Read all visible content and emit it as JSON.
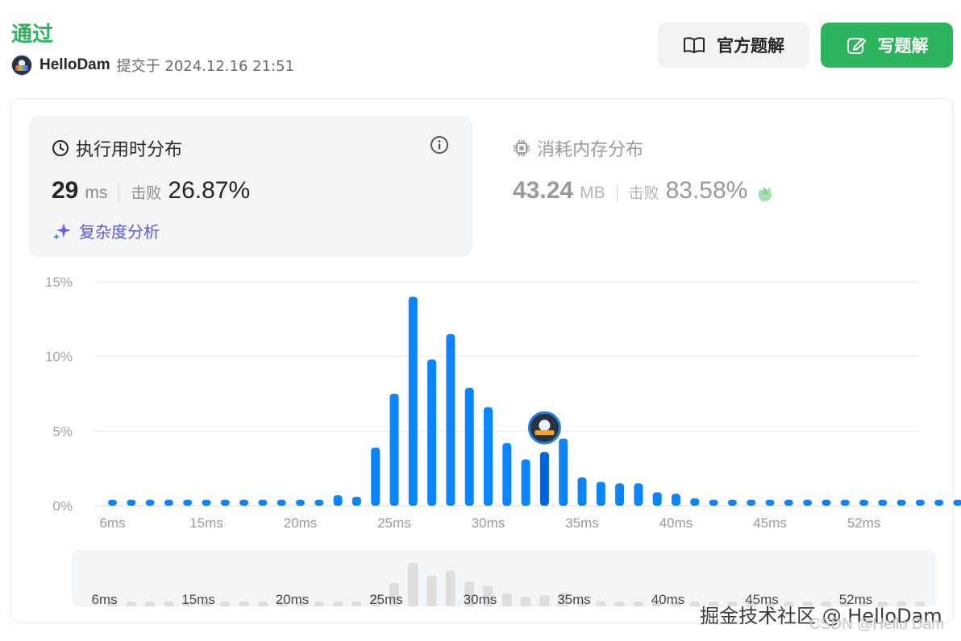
{
  "header": {
    "status": "通过",
    "username": "HelloDam",
    "submit_label": "提交于 2024.12.16 21:51"
  },
  "buttons": {
    "official_solution": "官方题解",
    "write_solution": "写题解"
  },
  "runtime": {
    "title": "执行用时分布",
    "value": "29",
    "unit": "ms",
    "beat_label": "击败",
    "beat_pct": "26.87%",
    "complexity_link": "复杂度分析"
  },
  "memory": {
    "title": "消耗内存分布",
    "value": "43.24",
    "unit": "MB",
    "beat_label": "击败",
    "beat_pct": "83.58%"
  },
  "colors": {
    "accent_green": "#2db55d",
    "bar_blue": "#0a84ff",
    "bar_highlight": "#0066d6",
    "complexity_purple": "#5a5ad8"
  },
  "chart_data": {
    "type": "bar",
    "x": [
      6,
      7,
      8,
      9,
      10,
      11,
      12,
      13,
      14,
      15,
      16,
      17,
      18,
      19,
      20,
      21,
      22,
      23,
      24,
      25,
      26,
      27,
      28,
      29,
      30,
      31,
      32,
      33,
      34,
      35,
      36,
      37,
      38,
      39,
      40,
      41,
      42,
      43,
      44,
      45,
      46,
      47,
      48,
      49,
      50,
      51,
      52,
      53,
      54,
      55
    ],
    "values": [
      0.4,
      0.4,
      0.4,
      0.4,
      0.4,
      0.4,
      0.4,
      0.4,
      0.4,
      0.4,
      0.4,
      0.4,
      0.7,
      0.6,
      3.9,
      7.5,
      14.0,
      9.8,
      11.5,
      7.9,
      6.6,
      4.2,
      3.1,
      3.6,
      4.5,
      1.9,
      1.6,
      1.5,
      1.5,
      0.9,
      0.8,
      0.5,
      0.4,
      0.4,
      0.4,
      0.4,
      0.4,
      0.4,
      0.4,
      0.4,
      0.4,
      0.4,
      0.4,
      0.4,
      0.4,
      0.4,
      0.4,
      0.4,
      0.4,
      0.4
    ],
    "highlight_x": 29,
    "x_tick_labels": [
      "6ms",
      "15ms",
      "20ms",
      "25ms",
      "30ms",
      "35ms",
      "40ms",
      "45ms",
      "52ms"
    ],
    "y_tick_labels": [
      "15%",
      "10%",
      "5%",
      "0%"
    ],
    "ylim": [
      0,
      15
    ],
    "grid": true
  },
  "watermarks": {
    "line1": "掘金技术社区 @ HelloDam",
    "line2": "CSDN @Hello Dam"
  }
}
